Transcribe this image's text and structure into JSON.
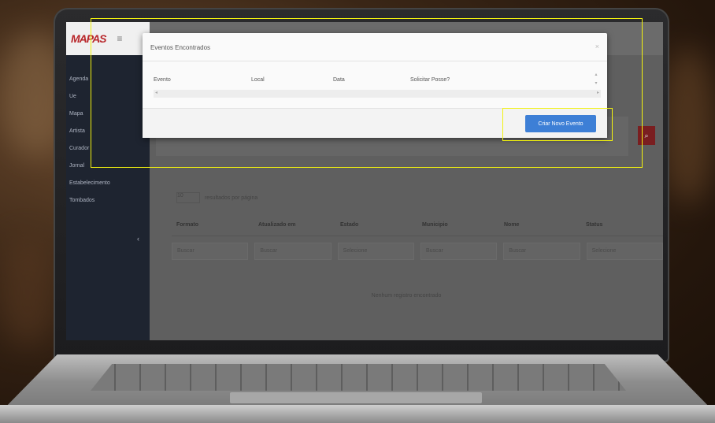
{
  "app": {
    "logo_text": "MAPAS",
    "menu_icon": "≡"
  },
  "sidebar": {
    "items": [
      {
        "label": "Agenda"
      },
      {
        "label": "Ue"
      },
      {
        "label": "Mapa"
      },
      {
        "label": "Artista"
      },
      {
        "label": "Curador"
      },
      {
        "label": "Jornal"
      },
      {
        "label": "Estabelecimento"
      },
      {
        "label": "Tombados"
      }
    ],
    "collapse_icon": "‹"
  },
  "main": {
    "per_page_label": "resultados por página",
    "per_page_value": "10",
    "columns": [
      "Formato",
      "Atualizado em",
      "Estado",
      "Municipio",
      "Nome",
      "Status"
    ],
    "filters": [
      "Buscar",
      "Buscar",
      "Selecione",
      "Buscar",
      "Buscar",
      "Selecione"
    ],
    "empty_message": "Nenhum registro encontrado",
    "search_icon": "⌕"
  },
  "modal": {
    "title": "Eventos Encontrados",
    "close_icon": "×",
    "columns": [
      "Evento",
      "Local",
      "Data",
      "Solicitar Posse?"
    ],
    "create_button_label": "Criar Novo Evento"
  },
  "colors": {
    "accent": "#3d7fd6",
    "brand": "#b8262a",
    "highlight": "#f2f20f"
  }
}
